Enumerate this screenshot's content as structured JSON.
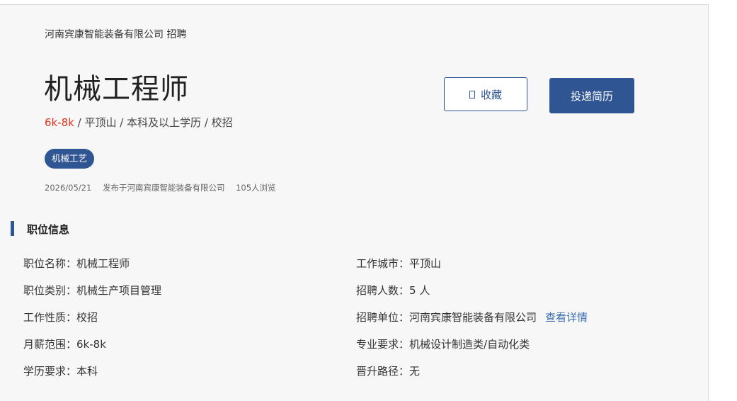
{
  "header": {
    "company_line": "河南宾康智能装备有限公司 招聘",
    "title": "机械工程师",
    "salary": "6k-8k",
    "summary_rest": " / 平顶山 / 本科及以上学历 / 校招",
    "tag": "机械工艺",
    "meta": {
      "date": "2026/05/21",
      "publisher": "发布于河南宾康智能装备有限公司",
      "views": "105人浏览"
    }
  },
  "actions": {
    "favorite_label": "收藏",
    "favorite_icon": "bookmark-icon",
    "apply_label": "投递简历"
  },
  "section": {
    "title": "职位信息"
  },
  "info_left": [
    {
      "label": "职位名称：",
      "value": "机械工程师"
    },
    {
      "label": "职位类别：",
      "value": "机械生产项目管理"
    },
    {
      "label": "工作性质：",
      "value": "校招"
    },
    {
      "label": "月薪范围：",
      "value": "6k-8k"
    },
    {
      "label": "学历要求：",
      "value": "本科"
    }
  ],
  "info_right": [
    {
      "label": "工作城市：",
      "value": "平顶山"
    },
    {
      "label": "招聘人数：",
      "value": "5 人"
    },
    {
      "label": "招聘单位：",
      "value": "河南宾康智能装备有限公司",
      "link": "查看详情"
    },
    {
      "label": "专业要求：",
      "value": "机械设计制造类/自动化类"
    },
    {
      "label": "晋升路径：",
      "value": "无"
    }
  ],
  "colors": {
    "accent": "#2f5593",
    "salary": "#e0321f",
    "link": "#3b6db0"
  }
}
